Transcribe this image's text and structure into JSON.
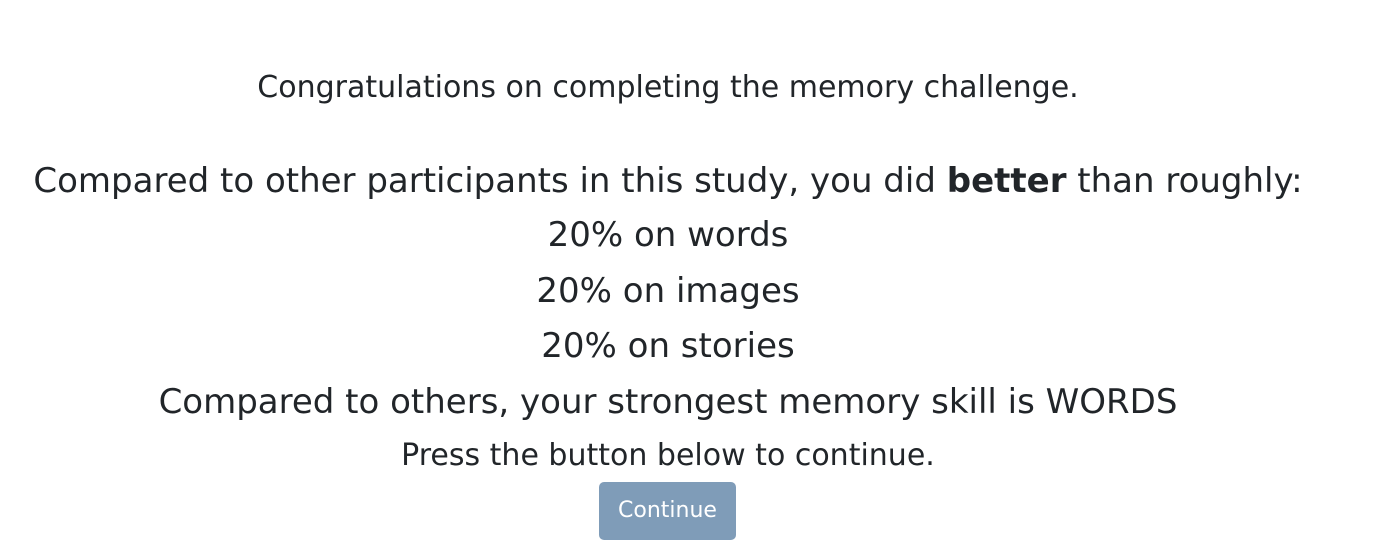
{
  "congrats_text": "Congratulations on completing the memory challenge.",
  "comparison": {
    "prefix": "Compared to other participants in this study, you did ",
    "emphasis": "better",
    "suffix": " than roughly:"
  },
  "scores": [
    {
      "text": "20% on words"
    },
    {
      "text": "20% on images"
    },
    {
      "text": "20% on stories"
    }
  ],
  "strongest_skill_text": "Compared to others, your strongest memory skill is WORDS",
  "instruction_text": "Press the button below to continue.",
  "continue_button": {
    "label": "Continue",
    "bg_color": "#7f9cb8"
  }
}
